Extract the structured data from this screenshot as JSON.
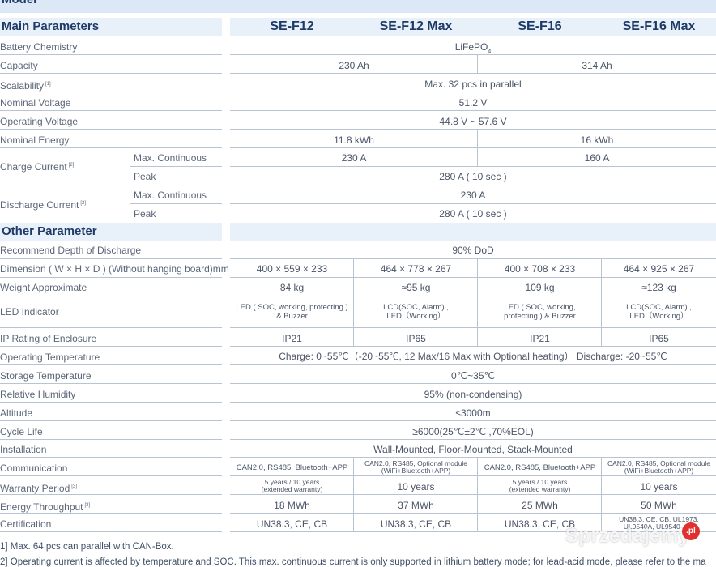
{
  "header": {
    "cut_title": "Model"
  },
  "sections": {
    "main": "Main Parameters",
    "other": "Other Parameter"
  },
  "models": [
    "SE-F12",
    "SE-F12 Max",
    "SE-F16",
    "SE-F16 Max"
  ],
  "main_rows": {
    "battery_chemistry": {
      "label": "Battery Chemistry",
      "value_main": "LiFePO",
      "value_sub": "4"
    },
    "capacity": {
      "label": "Capacity",
      "f12": "230 Ah",
      "f16": "314 Ah"
    },
    "scalability": {
      "label": "Scalability",
      "note": "[1]",
      "value": "Max. 32 pcs in parallel"
    },
    "nominal_voltage": {
      "label": "Nominal Voltage",
      "value": "51.2 V"
    },
    "operating_voltage": {
      "label": "Operating Voltage",
      "value": "44.8 V ~ 57.6 V"
    },
    "nominal_energy": {
      "label": "Nominal Energy",
      "f12": "11.8 kWh",
      "f16": "16 kWh"
    },
    "charge_current": {
      "label": "Charge Current",
      "note": "[2]",
      "sub1": "Max. Continuous",
      "sub1_f12": "230 A",
      "sub1_f16": "160 A",
      "sub2": "Peak",
      "sub2_value": "280 A ( 10 sec )"
    },
    "discharge_current": {
      "label": "Discharge Current",
      "note": "[2]",
      "sub1": "Max. Continuous",
      "sub1_value": "230 A",
      "sub2": "Peak",
      "sub2_value": "280 A ( 10 sec )"
    }
  },
  "other_rows": {
    "dod": {
      "label": "Recommend Depth of Discharge",
      "value": "90% DoD"
    },
    "dimension": {
      "label": "Dimension ( W × H × D ) (Without hanging board)mm",
      "values": [
        "400 × 559 × 233",
        "464 × 778 × 267",
        "400 × 708  × 233",
        "464 × 925 × 267"
      ]
    },
    "weight": {
      "label": "Weight Approximate",
      "values": [
        "84 kg",
        "≈95 kg",
        "109 kg",
        "≈123 kg"
      ]
    },
    "led": {
      "label": "LED Indicator",
      "values": [
        [
          "LED ( SOC, working, protecting )",
          "& Buzzer"
        ],
        [
          "LCD(SOC, Alarm) ,",
          "LED（Working）"
        ],
        [
          "LED ( SOC, working,",
          "protecting ) & Buzzer"
        ],
        [
          "LCD(SOC, Alarm) ,",
          "LED（Working）"
        ]
      ]
    },
    "ip": {
      "label": "IP Rating of Enclosure",
      "values": [
        "IP21",
        "IP65",
        "IP21",
        "IP65"
      ]
    },
    "op_temp": {
      "label": "Operating Temperature",
      "value": "Charge: 0~55℃（-20~55℃, 12 Max/16 Max with Optional heating）   Discharge: -20~55℃"
    },
    "storage_temp": {
      "label": "Storage Temperature",
      "value": "0℃~35℃"
    },
    "humidity": {
      "label": "Relative Humidity",
      "value": "95% (non-condensing)"
    },
    "altitude": {
      "label": "Altitude",
      "value": "≤3000m"
    },
    "cycle_life": {
      "label": "Cycle Life",
      "value": "≥6000(25℃±2℃ ,70%EOL)"
    },
    "installation": {
      "label": "Installation",
      "value": "Wall-Mounted, Floor-Mounted, Stack-Mounted"
    },
    "communication": {
      "label": "Communication",
      "values": [
        [
          "CAN2.0, RS485, Bluetooth+APP"
        ],
        [
          "CAN2.0, RS485, Optional module",
          "(WiFi+Bluetooth+APP)"
        ],
        [
          "CAN2.0, RS485, Bluetooth+APP"
        ],
        [
          "CAN2.0, RS485, Optional module",
          "(WiFi+Bluetooth+APP)"
        ]
      ]
    },
    "warranty": {
      "label": "Warranty Period",
      "note": "[3]",
      "values": [
        [
          "5 years / 10 years",
          "(extended warranty)"
        ],
        [
          "10 years"
        ],
        [
          "5 years / 10 years",
          "(extended warranty)"
        ],
        [
          "10 years"
        ]
      ]
    },
    "throughput": {
      "label": "Energy Throughput",
      "note": "[3]",
      "values": [
        "18 MWh",
        "37 MWh",
        "25 MWh",
        "50 MWh"
      ]
    },
    "certification": {
      "label": "Certification",
      "values": [
        [
          "UN38.3, CE, CB"
        ],
        [
          "UN38.3, CE, CB"
        ],
        [
          "UN38.3, CE, CB"
        ],
        [
          "UN38.3, CE, CB, UL1973,",
          "UL9540A, UL9540-   CC"
        ]
      ]
    }
  },
  "footnotes": [
    "1] Max. 64 pcs can parallel with CAN-Box.",
    "2] Operating current is affected by temperature and SOC. This max. continuous current is only supported in lithium battery mode; for lead-acid mode, please refer to the ma"
  ],
  "watermark": {
    "text": "Sprzedajemy",
    "badge": ".pl"
  }
}
